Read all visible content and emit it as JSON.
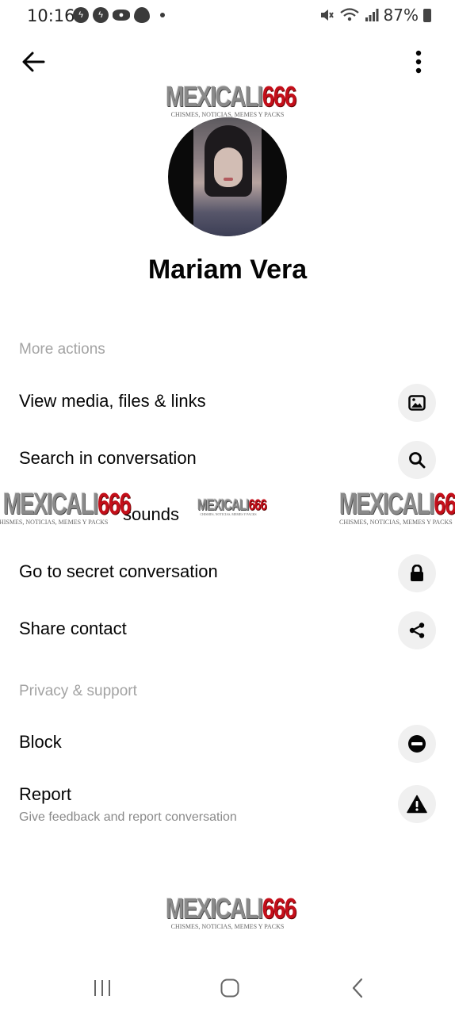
{
  "status_bar": {
    "time": "10:16",
    "battery": "87%",
    "icons": [
      "messenger-icon",
      "messenger-icon",
      "eye-icon",
      "fire-icon",
      "mute-icon",
      "wifi-icon",
      "signal-icon",
      "battery-icon"
    ]
  },
  "profile": {
    "name": "Mariam Vera"
  },
  "sections": {
    "more_actions": "More actions",
    "privacy_support": "Privacy & support"
  },
  "actions": {
    "view_media": "View media, files & links",
    "search": "Search in conversation",
    "sounds": "sounds",
    "secret": "Go to secret conversation",
    "share_contact": "Share contact",
    "block": "Block",
    "report": "Report",
    "report_sub": "Give feedback and report conversation"
  },
  "watermark": {
    "main_a": "MEXICALI",
    "main_b": "666",
    "sub": "CHISMES, NOTICIAS, MEMES Y PACKS"
  },
  "colors": {
    "text": "#050505",
    "section_label": "#a3a3a3",
    "icon_bg": "#f0f0f0",
    "watermark_red": "#c40f1a"
  }
}
